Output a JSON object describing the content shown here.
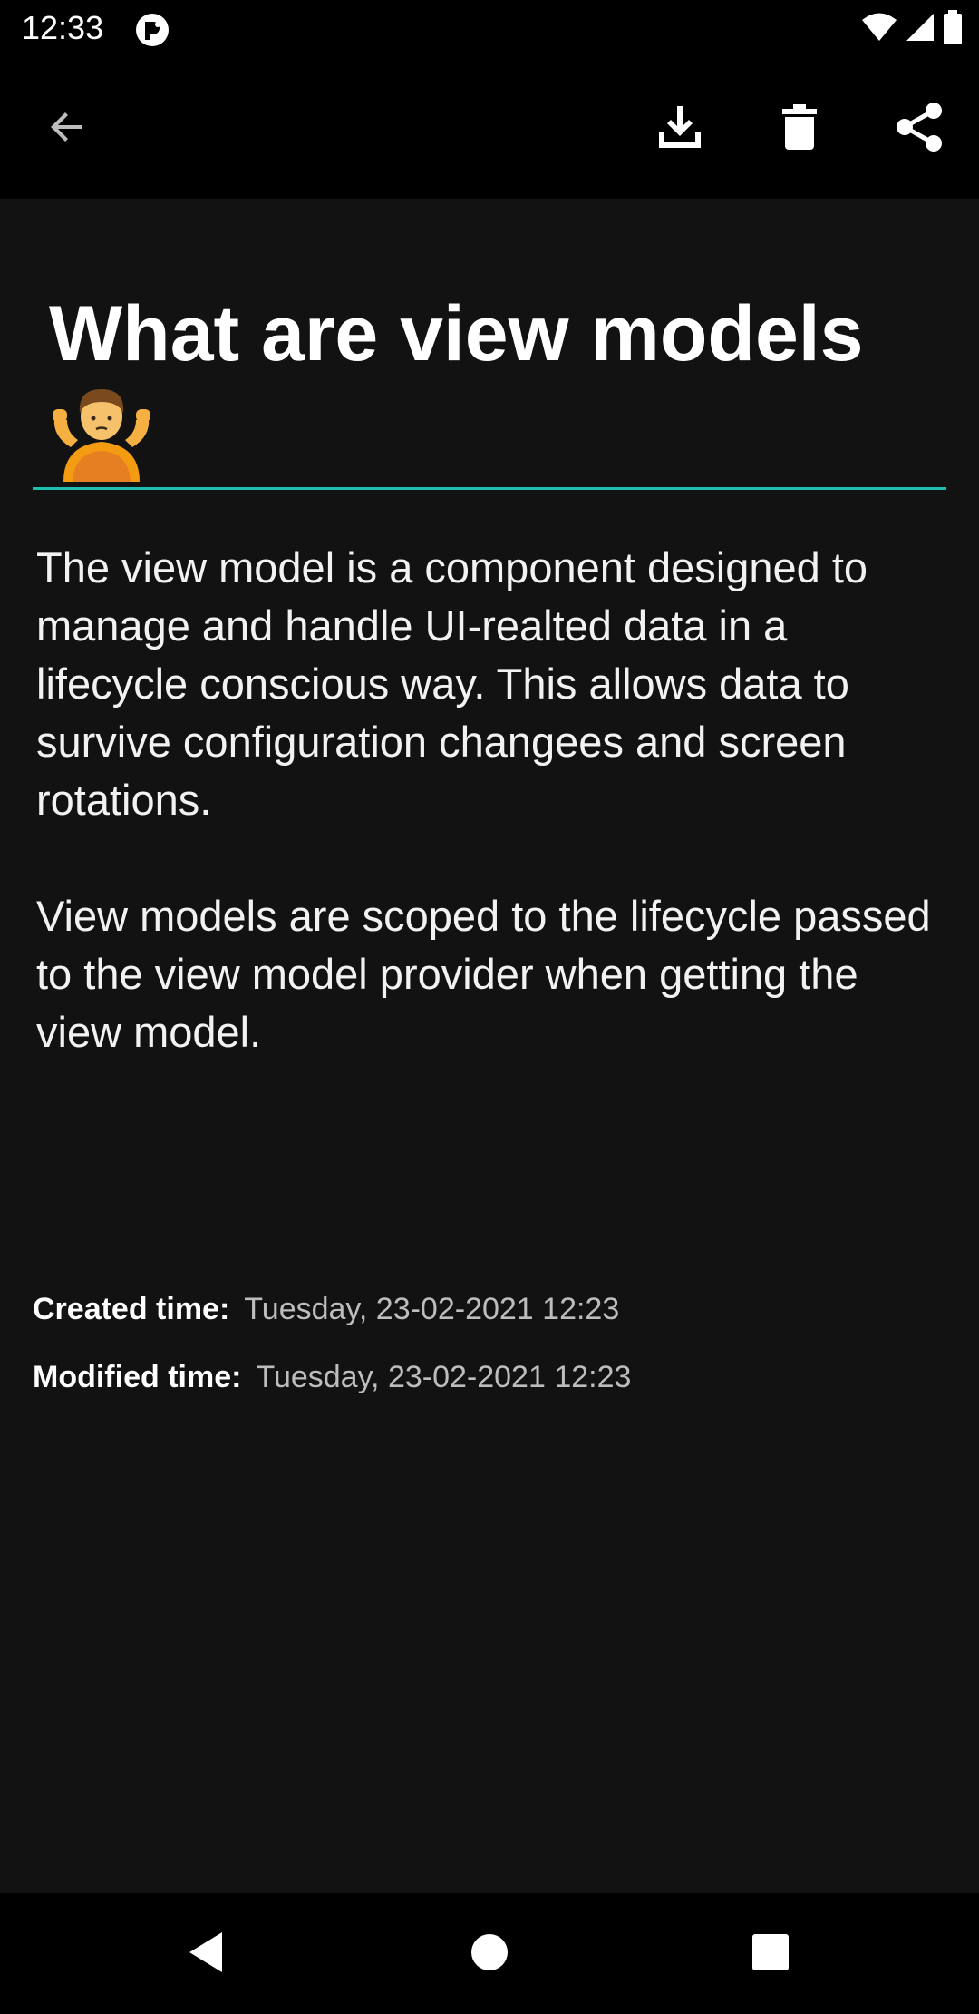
{
  "status_bar": {
    "time": "12:33",
    "icons": [
      "app-notification-icon",
      "wifi-icon",
      "cellular-signal-icon",
      "battery-icon"
    ]
  },
  "toolbar": {
    "icons": [
      "back-arrow-icon",
      "download-icon",
      "trash-icon",
      "share-icon"
    ]
  },
  "note": {
    "title": "What are view models",
    "title_emoji": "person-shrugging-emoji",
    "paragraphs": [
      "The view model is a component designed to manage and handle UI-realted data in a lifecycle conscious way. This allows data to survive configuration changees and screen rotations.",
      "View models are scoped to the lifecycle passed to the view model provider when getting the view model."
    ]
  },
  "meta": {
    "created_label": "Created time:",
    "created_value": "Tuesday, 23-02-2021 12:23",
    "modified_label": "Modified time:",
    "modified_value": "Tuesday, 23-02-2021 12:23"
  },
  "nav_bar": {
    "icons": [
      "nav-back-icon",
      "nav-home-icon",
      "nav-recents-icon"
    ]
  },
  "colors": {
    "accent_underline": "#1fbfb0",
    "background": "#121212",
    "bar_background": "#000000"
  }
}
